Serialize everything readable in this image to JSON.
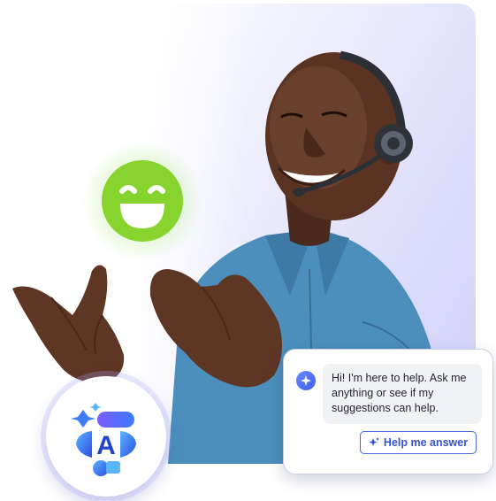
{
  "chat": {
    "message": "Hi! I'm here to help. Ask me anything or see if my suggestions can help.",
    "button_label": "Help me answer"
  },
  "icons": {
    "smiley": "smiley-face-icon",
    "logo": "assistant-logo-icon",
    "bot": "sparkle-icon",
    "button": "sparkle-icon"
  },
  "colors": {
    "accent": "#3552d6",
    "smiley": "#86d42d",
    "card_bg": "#d6d4fa"
  }
}
